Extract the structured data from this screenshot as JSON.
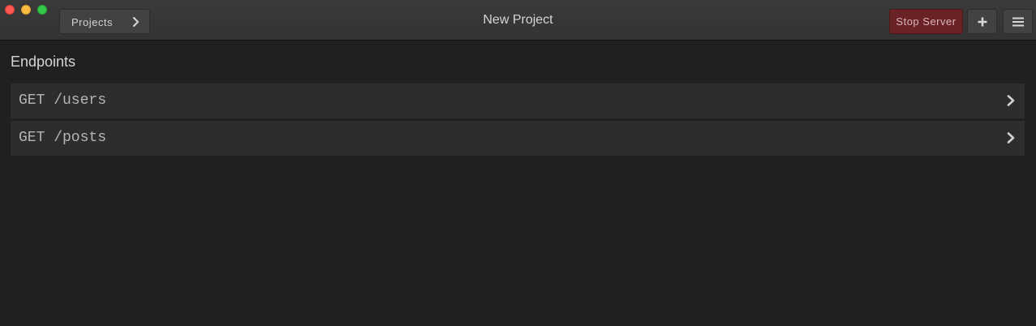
{
  "window": {
    "title": "New Project"
  },
  "toolbar": {
    "projects_label": "Projects",
    "stop_server_label": "Stop Server",
    "add_icon": "plus-icon",
    "menu_icon": "hamburger-menu-icon",
    "stop_server_color": "#6b2226"
  },
  "main": {
    "section_title": "Endpoints",
    "endpoints": [
      {
        "label": "GET /users"
      },
      {
        "label": "GET /posts"
      }
    ]
  },
  "colors": {
    "background": "#202020",
    "titlebar": "#353535",
    "row": "#2d2d2d"
  }
}
